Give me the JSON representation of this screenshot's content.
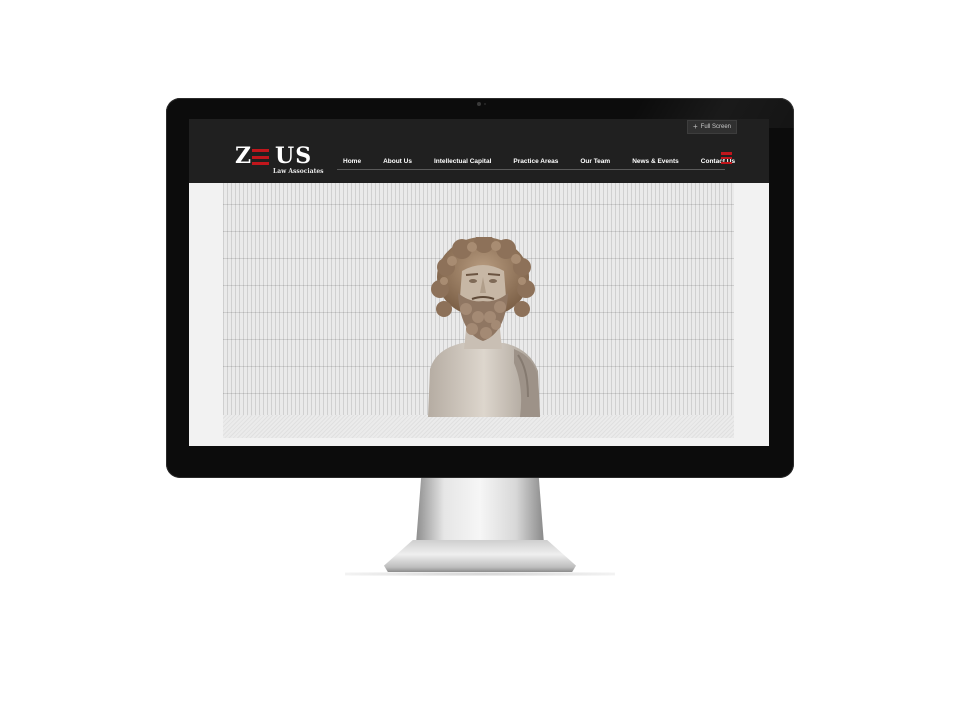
{
  "site": {
    "logo": {
      "word": "Z US",
      "subtitle": "Law Associates"
    },
    "fullscreen_label": "Full Screen",
    "nav": [
      {
        "label": "Home"
      },
      {
        "label": "About Us"
      },
      {
        "label": "Intellectual Capital"
      },
      {
        "label": "Practice Areas"
      },
      {
        "label": "Our Team"
      },
      {
        "label": "News & Events"
      },
      {
        "label": "Contact Us"
      }
    ],
    "slider": {
      "slides": 5,
      "active_index": 0
    }
  },
  "colors": {
    "header_bg": "#202020",
    "accent_red": "#c1161c",
    "monitor_bezel": "#0c0c0c"
  },
  "icons": [
    "plus-icon",
    "hamburger-menu-icon"
  ]
}
